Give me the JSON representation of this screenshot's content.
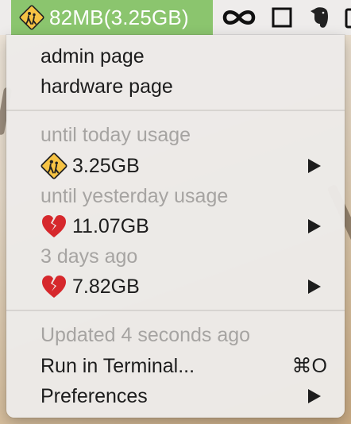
{
  "menubar": {
    "status_title": "82MB(3.25GB)",
    "status_icon": "school-crossing-warning-icon",
    "tray_icons": [
      "infinity-icon",
      "square-window-icon",
      "evernote-elephant-icon"
    ]
  },
  "menu": {
    "admin_page": "admin page",
    "hardware_page": "hardware page",
    "until_today_header": "until today usage",
    "today_value": "3.25GB",
    "until_yesterday_header": "until yesterday usage",
    "yesterday_value": "11.07GB",
    "three_days_header": "3 days ago",
    "three_days_value": "7.82GB",
    "updated": "Updated 4 seconds ago",
    "run_terminal": "Run in Terminal...",
    "run_terminal_shortcut": "⌘O",
    "preferences": "Preferences"
  },
  "colors": {
    "status_green": "#8bc56e",
    "warning_yellow": "#f6c344",
    "broken_heart_red": "#d6282c",
    "disabled_text": "#a6a4a2"
  }
}
